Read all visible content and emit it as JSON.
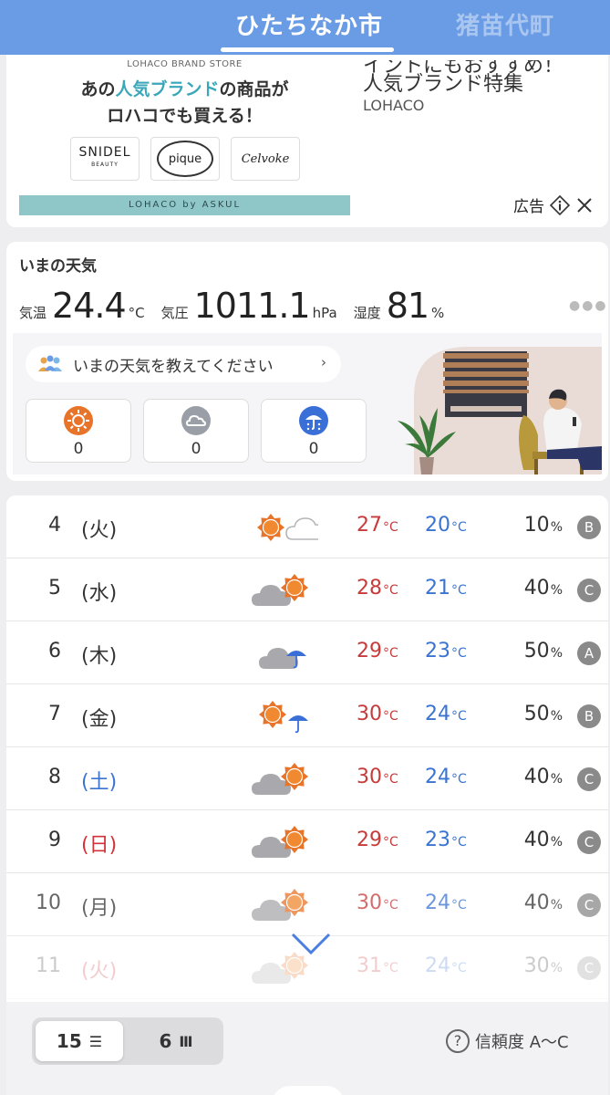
{
  "header": {
    "tab_active": "ひたちなか市",
    "tab_inactive": "猪苗代町"
  },
  "ad": {
    "brand_store": "LOHACO BRAND STORE",
    "headline_pre": "あの",
    "headline_highlight": "人気ブランド",
    "headline_post": "の商品が",
    "headline_line2": "ロハコでも買える！",
    "brands": [
      "SNIDEL",
      "pique",
      "Celvoke"
    ],
    "brand_sub": "BEAUTY",
    "footer": "LOHACO by ASKUL",
    "text_line1": "イントにもおすすめ！",
    "text_line2": "人気ブランド特集",
    "sponsor": "LOHACO",
    "ad_label": "広告"
  },
  "now": {
    "title": "いまの天気",
    "temp_label": "気温",
    "temp_value": "24.4",
    "temp_unit": "°C",
    "pressure_label": "気圧",
    "pressure_value": "1011.1",
    "pressure_unit": "hPa",
    "humidity_label": "湿度",
    "humidity_value": "81",
    "humidity_unit": "%",
    "more_icon": "more-dots-icon",
    "report_prompt": "いまの天気を教えてください",
    "votes": [
      {
        "icon": "sunny-icon",
        "count": "0",
        "color": "#e8742a"
      },
      {
        "icon": "cloudy-icon",
        "count": "0",
        "color": "#9a9ea6"
      },
      {
        "icon": "rain-icon",
        "count": "0",
        "color": "#3b6fd8"
      }
    ]
  },
  "forecast": {
    "rows": [
      {
        "day": "4",
        "weekday": "(火)",
        "weekday_type": "weekday",
        "icon": "sun-then-cloud-icon",
        "high": "27",
        "low": "20",
        "rain": "10",
        "reliability": "B"
      },
      {
        "day": "5",
        "weekday": "(水)",
        "weekday_type": "weekday",
        "icon": "cloud-then-sun-icon",
        "high": "28",
        "low": "21",
        "rain": "40",
        "reliability": "C"
      },
      {
        "day": "6",
        "weekday": "(木)",
        "weekday_type": "weekday",
        "icon": "cloud-then-rain-icon",
        "high": "29",
        "low": "23",
        "rain": "50",
        "reliability": "A"
      },
      {
        "day": "7",
        "weekday": "(金)",
        "weekday_type": "weekday",
        "icon": "sun-then-rain-icon",
        "high": "30",
        "low": "24",
        "rain": "50",
        "reliability": "B"
      },
      {
        "day": "8",
        "weekday": "(土)",
        "weekday_type": "sat",
        "icon": "cloud-then-sun-icon",
        "high": "30",
        "low": "24",
        "rain": "40",
        "reliability": "C"
      },
      {
        "day": "9",
        "weekday": "(日)",
        "weekday_type": "sun",
        "icon": "cloud-then-sun-icon",
        "high": "29",
        "low": "23",
        "rain": "40",
        "reliability": "C"
      },
      {
        "day": "10",
        "weekday": "(月)",
        "weekday_type": "weekday",
        "icon": "cloud-then-sun-icon",
        "high": "30",
        "low": "24",
        "rain": "40",
        "reliability": "C"
      },
      {
        "day": "11",
        "weekday": "(火)",
        "weekday_type": "sun",
        "icon": "cloud-then-sun-icon",
        "high": "31",
        "low": "24",
        "rain": "30",
        "reliability": "C"
      }
    ],
    "temp_unit": "°C",
    "rain_unit": "%"
  },
  "bottom": {
    "seg_15": "15",
    "seg_6": "6",
    "help_label": "信頼度 A〜C",
    "help_icon_text": "?"
  },
  "colors": {
    "header_bg": "#6a9ce6",
    "high_temp": "#c83b3b",
    "low_temp": "#3a74d0",
    "sun": "#e8742a"
  }
}
